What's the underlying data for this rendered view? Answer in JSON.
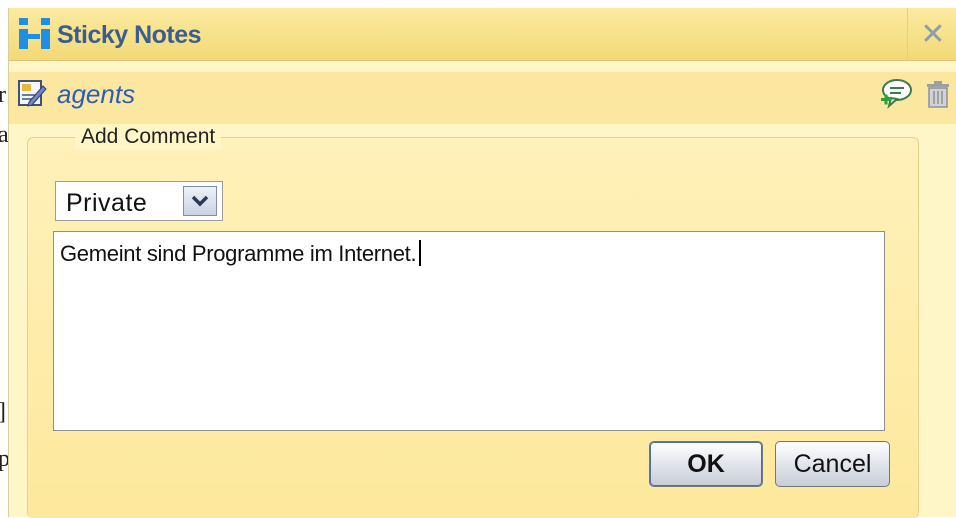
{
  "window": {
    "title": "Sticky Notes",
    "close_glyph": "✕",
    "icon": "app-logo"
  },
  "note": {
    "title": "agents",
    "icon": "note-edit-icon",
    "actions": [
      {
        "icon": "add-comment-icon"
      },
      {
        "icon": "trash-icon"
      }
    ]
  },
  "form": {
    "legend": "Add Comment",
    "visibility": {
      "selected": "Private"
    },
    "comment_value": "Gemeint sind Programme im Internet.",
    "ok_label": "OK",
    "cancel_label": "Cancel"
  },
  "colors": {
    "title_text": "#3b5d8f",
    "note_title": "#2a5fb8",
    "panel_bg": "#fde89c"
  }
}
